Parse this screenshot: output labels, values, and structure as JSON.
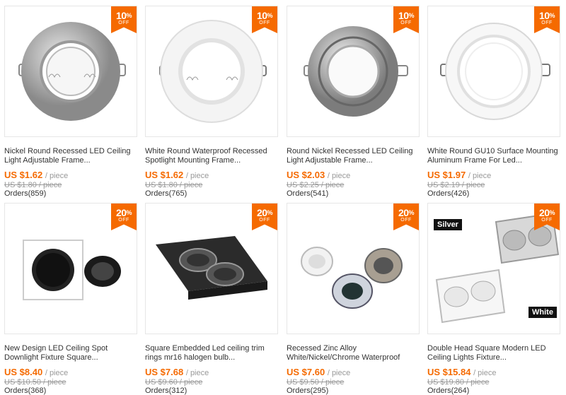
{
  "products": [
    {
      "badge_num": "10",
      "badge_pct": "%",
      "badge_off": "OFF",
      "title": "Nickel Round Recessed LED Ceiling Light Adjustable Frame...",
      "price": "US $1.62",
      "unit": "/ piece",
      "old_price": "US $1.80 / piece",
      "orders": "Orders(859)"
    },
    {
      "badge_num": "10",
      "badge_pct": "%",
      "badge_off": "OFF",
      "title": "White Round Waterproof Recessed Spotlight Mounting Frame...",
      "price": "US $1.62",
      "unit": "/ piece",
      "old_price": "US $1.80 / piece",
      "orders": "Orders(765)"
    },
    {
      "badge_num": "10",
      "badge_pct": "%",
      "badge_off": "OFF",
      "title": "Round Nickel Recessed LED Ceiling Light Adjustable Frame...",
      "price": "US $2.03",
      "unit": "/ piece",
      "old_price": "US $2.25 / piece",
      "orders": "Orders(541)"
    },
    {
      "badge_num": "10",
      "badge_pct": "%",
      "badge_off": "OFF",
      "title": "White Round GU10 Surface Mounting Aluminum Frame For Led...",
      "price": "US $1.97",
      "unit": "/ piece",
      "old_price": "US $2.19 / piece",
      "orders": "Orders(426)"
    },
    {
      "badge_num": "20",
      "badge_pct": "%",
      "badge_off": "OFF",
      "title": "New Design LED Ceiling Spot Downlight Fixture Square...",
      "price": "US $8.40",
      "unit": "/ piece",
      "old_price": "US $10.50 / piece",
      "orders": "Orders(368)"
    },
    {
      "badge_num": "20",
      "badge_pct": "%",
      "badge_off": "OFF",
      "title": "Square Embedded Led ceiling trim rings mr16 halogen bulb...",
      "price": "US $7.68",
      "unit": "/ piece",
      "old_price": "US $9.60 / piece",
      "orders": "Orders(312)"
    },
    {
      "badge_num": "20",
      "badge_pct": "%",
      "badge_off": "OFF",
      "title": "Recessed Zinc Alloy White/Nickel/Chrome Waterproof",
      "price": "US $7.60",
      "unit": "/ piece",
      "old_price": "US $9.50 / piece",
      "orders": "Orders(295)"
    },
    {
      "badge_num": "20",
      "badge_pct": "%",
      "badge_off": "OFF",
      "title": "Double Head Square Modern LED Ceiling Lights Fixture...",
      "price": "US $15.84",
      "unit": "/ piece",
      "old_price": "US $19.80 / piece",
      "orders": "Orders(264)",
      "tag_silver": "Silver",
      "tag_white": "White"
    }
  ]
}
